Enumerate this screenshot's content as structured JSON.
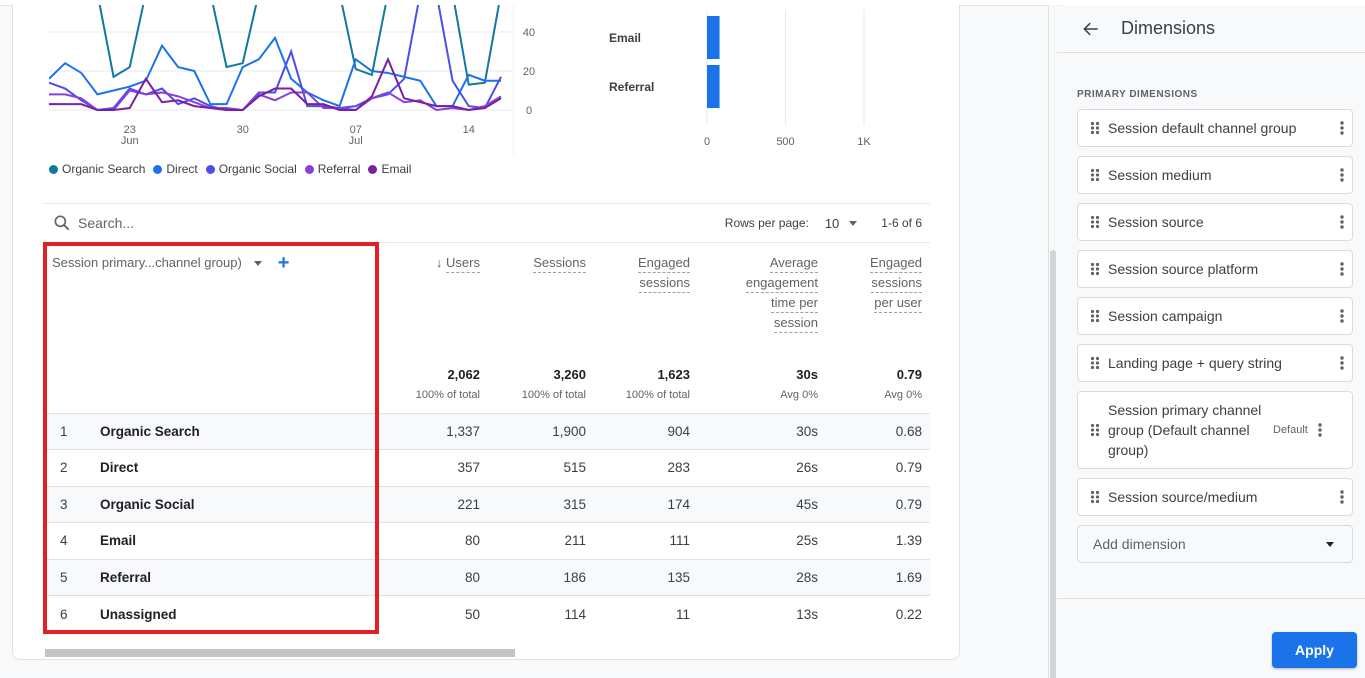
{
  "line_chart": {
    "type": "line",
    "x_tick_labels": [
      {
        "day": "23",
        "month": "Jun",
        "index": 5
      },
      {
        "day": "30",
        "month": "",
        "index": 12
      },
      {
        "day": "07",
        "month": "Jul",
        "index": 19
      },
      {
        "day": "14",
        "month": "",
        "index": 26
      }
    ],
    "y_ticks": [
      0,
      20,
      40
    ],
    "ylim": [
      0,
      45
    ],
    "series": [
      {
        "name": "Organic Search",
        "color": "#12799e",
        "values": [
          60,
          60,
          60,
          60,
          17,
          22,
          60,
          60,
          60,
          60,
          60,
          22,
          24,
          60,
          60,
          60,
          60,
          60,
          60,
          21,
          18,
          60,
          60,
          60,
          60,
          60,
          13,
          14,
          60
        ]
      },
      {
        "name": "Direct",
        "color": "#1a73e8",
        "values": [
          16,
          24,
          19,
          8,
          10,
          12,
          15,
          33,
          22,
          20,
          3,
          3,
          22,
          26,
          37,
          16,
          9,
          5,
          2,
          26,
          20,
          19,
          17,
          15,
          2,
          2,
          18,
          15,
          15
        ]
      },
      {
        "name": "Organic Social",
        "color": "#4b4ee8",
        "values": [
          14,
          11,
          5,
          0,
          1,
          11,
          8,
          11,
          3,
          6,
          2,
          0,
          0,
          9,
          9,
          30,
          2,
          2,
          1,
          2,
          6,
          8,
          16,
          60,
          60,
          15,
          2,
          1,
          17
        ]
      },
      {
        "name": "Referral",
        "color": "#8b3fd9",
        "values": [
          8,
          8,
          6,
          0,
          0,
          10,
          8,
          9,
          7,
          4,
          1,
          1,
          0,
          8,
          5,
          9,
          9,
          1,
          1,
          0,
          6,
          9,
          4,
          5,
          0,
          1,
          0,
          2,
          7
        ]
      },
      {
        "name": "Email",
        "color": "#7b1fa2",
        "values": [
          3,
          3,
          3,
          0,
          0,
          1,
          16,
          4,
          5,
          2,
          1,
          0,
          0,
          7,
          11,
          11,
          3,
          3,
          0,
          0,
          7,
          26,
          6,
          4,
          2,
          2,
          0,
          1,
          6
        ]
      }
    ]
  },
  "bar_chart": {
    "type": "bar",
    "orientation": "horizontal",
    "categories": [
      "Email",
      "Referral"
    ],
    "values": [
      80,
      80
    ],
    "x_ticks": [
      "0",
      "500",
      "1K"
    ],
    "xlim": [
      0,
      1500
    ],
    "color": "#1a73e8"
  },
  "legend": [
    {
      "label": "Organic Search",
      "color": "#12799e"
    },
    {
      "label": "Direct",
      "color": "#1a73e8"
    },
    {
      "label": "Organic Social",
      "color": "#4b4ee8"
    },
    {
      "label": "Referral",
      "color": "#8b3fd9"
    },
    {
      "label": "Email",
      "color": "#7b1fa2"
    }
  ],
  "toolbar": {
    "search_placeholder": "Search...",
    "rows_per_page_label": "Rows per page:",
    "rows_per_page_value": "10",
    "pagination": "1-6 of 6"
  },
  "table": {
    "dimension_header": "Session primary...channel group)",
    "columns": [
      {
        "label": "Users",
        "sorted": "↓",
        "lines": [
          "Users"
        ]
      },
      {
        "label": "Sessions",
        "lines": [
          "Sessions"
        ]
      },
      {
        "label": "Engaged sessions",
        "lines": [
          "Engaged",
          "sessions"
        ]
      },
      {
        "label": "Average engagement time per session",
        "lines": [
          "Average",
          "engagement",
          "time per",
          "session"
        ]
      },
      {
        "label": "Engaged sessions per user",
        "lines": [
          "Engaged",
          "sessions",
          "per user"
        ]
      }
    ],
    "totals": [
      {
        "value": "2,062",
        "sub": "100% of total"
      },
      {
        "value": "3,260",
        "sub": "100% of total"
      },
      {
        "value": "1,623",
        "sub": "100% of total"
      },
      {
        "value": "30s",
        "sub": "Avg 0%"
      },
      {
        "value": "0.79",
        "sub": "Avg 0%"
      }
    ],
    "rows": [
      {
        "index": "1",
        "name": "Organic Search",
        "values": [
          "1,337",
          "1,900",
          "904",
          "30s",
          "0.68"
        ]
      },
      {
        "index": "2",
        "name": "Direct",
        "values": [
          "357",
          "515",
          "283",
          "26s",
          "0.79"
        ]
      },
      {
        "index": "3",
        "name": "Organic Social",
        "values": [
          "221",
          "315",
          "174",
          "45s",
          "0.79"
        ]
      },
      {
        "index": "4",
        "name": "Email",
        "values": [
          "80",
          "211",
          "111",
          "25s",
          "1.39"
        ]
      },
      {
        "index": "5",
        "name": "Referral",
        "values": [
          "80",
          "186",
          "135",
          "28s",
          "1.69"
        ]
      },
      {
        "index": "6",
        "name": "Unassigned",
        "values": [
          "50",
          "114",
          "11",
          "13s",
          "0.22"
        ]
      }
    ],
    "highlight_color": "#e31e24"
  },
  "panel": {
    "title": "Dimensions",
    "section_label": "PRIMARY DIMENSIONS",
    "items": [
      {
        "label": "Session default channel group",
        "badge": ""
      },
      {
        "label": "Session medium",
        "badge": ""
      },
      {
        "label": "Session source",
        "badge": ""
      },
      {
        "label": "Session source platform",
        "badge": ""
      },
      {
        "label": "Session campaign",
        "badge": ""
      },
      {
        "label": "Landing page + query string",
        "badge": ""
      },
      {
        "label": "Session primary channel group (Default channel group)",
        "badge": "Default"
      },
      {
        "label": "Session source/medium",
        "badge": ""
      }
    ],
    "add_dimension_placeholder": "Add dimension",
    "apply_label": "Apply",
    "accent": "#1a73e8"
  }
}
